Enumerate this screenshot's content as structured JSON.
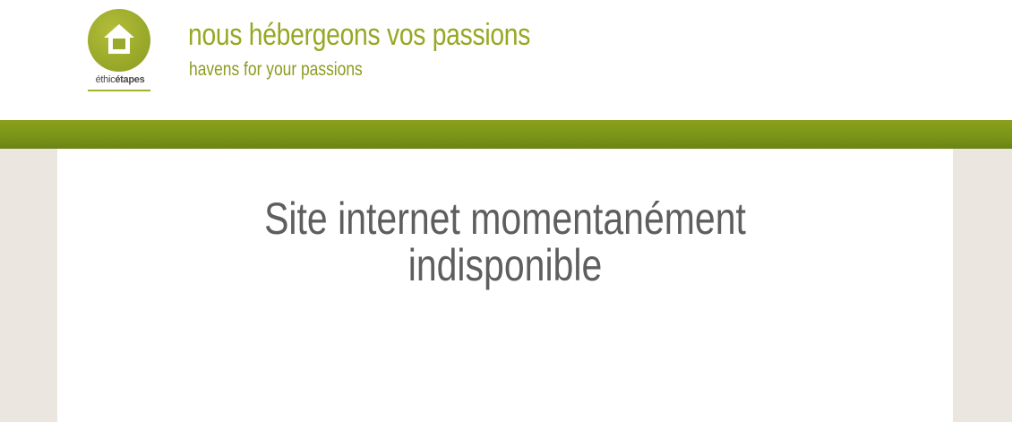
{
  "header": {
    "logo": {
      "text_light": "éthic",
      "text_bold": "étapes",
      "icon": "house-icon",
      "color": "#9aa92a"
    },
    "tagline_fr": "nous hébergeons vos passions",
    "tagline_en": "havens for your passions"
  },
  "colors": {
    "accent": "#98a722",
    "bar": "#7a9418",
    "side_background": "#ebe7e0",
    "text": "#5e5e5e"
  },
  "main": {
    "message_line1": "Site internet momentanément",
    "message_line2": "indisponible"
  }
}
